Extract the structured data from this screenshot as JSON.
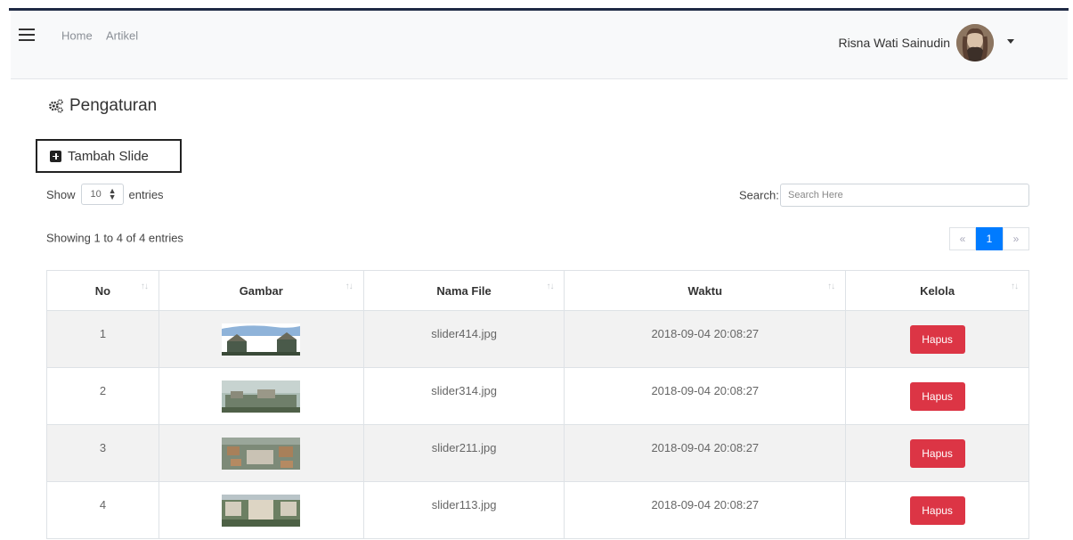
{
  "nav": {
    "home_label": "Home",
    "artikel_label": "Artikel",
    "user_name": "Risna Wati Sainudin"
  },
  "page": {
    "title": "Pengaturan",
    "add_button_label": "Tambah Slide"
  },
  "table_controls": {
    "show_label": "Show",
    "entries_value": "10",
    "entries_label": "entries",
    "search_label": "Search:",
    "search_placeholder": "Search Here",
    "info_text": "Showing 1 to 4 of 4 entries"
  },
  "pagination": {
    "prev": "«",
    "current": "1",
    "next": "»"
  },
  "table": {
    "headers": [
      "No",
      "Gambar",
      "Nama File",
      "Waktu",
      "Kelola"
    ],
    "rows": [
      {
        "no": "1",
        "file": "slider414.jpg",
        "time": "2018-09-04 20:08:27",
        "action": "Hapus"
      },
      {
        "no": "2",
        "file": "slider314.jpg",
        "time": "2018-09-04 20:08:27",
        "action": "Hapus"
      },
      {
        "no": "3",
        "file": "slider211.jpg",
        "time": "2018-09-04 20:08:27",
        "action": "Hapus"
      },
      {
        "no": "4",
        "file": "slider113.jpg",
        "time": "2018-09-04 20:08:27",
        "action": "Hapus"
      }
    ]
  },
  "colors": {
    "danger": "#dc3545",
    "primary": "#007bff",
    "navbar_bg": "#f8f9fa",
    "striped_row": "#f2f2f2"
  },
  "icons": [
    "hamburger-icon",
    "cogs-icon",
    "plus-square-icon",
    "caret-down-icon",
    "sort-icon"
  ]
}
